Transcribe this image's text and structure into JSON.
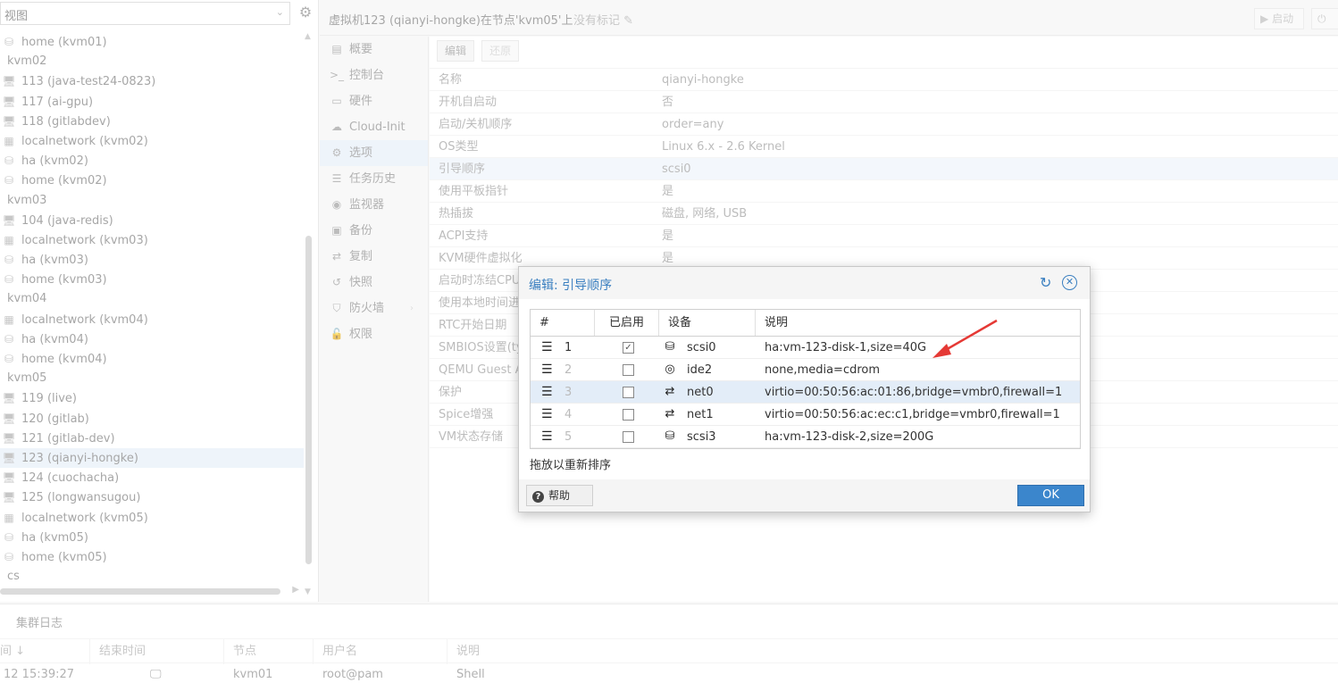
{
  "tree": {
    "view_label": "视图",
    "rows": [
      {
        "kind": "storage",
        "label": "home (kvm01)"
      },
      {
        "kind": "node",
        "label": "kvm02"
      },
      {
        "kind": "vm",
        "label": "113 (java-test24-0823)"
      },
      {
        "kind": "vm",
        "label": "117 (ai-gpu)"
      },
      {
        "kind": "vm",
        "label": "118 (gitlabdev)"
      },
      {
        "kind": "network",
        "label": "localnetwork (kvm02)"
      },
      {
        "kind": "storage",
        "label": "ha (kvm02)"
      },
      {
        "kind": "storage",
        "label": "home (kvm02)"
      },
      {
        "kind": "node",
        "label": "kvm03"
      },
      {
        "kind": "vm",
        "label": "104 (java-redis)"
      },
      {
        "kind": "network",
        "label": "localnetwork (kvm03)"
      },
      {
        "kind": "storage",
        "label": "ha (kvm03)"
      },
      {
        "kind": "storage",
        "label": "home (kvm03)"
      },
      {
        "kind": "node",
        "label": "kvm04"
      },
      {
        "kind": "network",
        "label": "localnetwork (kvm04)"
      },
      {
        "kind": "storage",
        "label": "ha (kvm04)"
      },
      {
        "kind": "storage",
        "label": "home (kvm04)"
      },
      {
        "kind": "node",
        "label": "kvm05"
      },
      {
        "kind": "vm",
        "label": "119 (live)"
      },
      {
        "kind": "vm",
        "label": "120 (gitlab)"
      },
      {
        "kind": "vm",
        "label": "121 (gitlab-dev)"
      },
      {
        "kind": "vm",
        "label": "123 (qianyi-hongke)",
        "selected": true
      },
      {
        "kind": "vm",
        "label": "124 (cuochacha)"
      },
      {
        "kind": "vm-off",
        "label": "125 (longwansugou)"
      },
      {
        "kind": "network",
        "label": "localnetwork (kvm05)"
      },
      {
        "kind": "storage",
        "label": "ha (kvm05)"
      },
      {
        "kind": "storage",
        "label": "home (kvm05)"
      },
      {
        "kind": "node",
        "label": "cs"
      }
    ]
  },
  "header": {
    "title": "虚拟机123 (qianyi-hongke)在节点'kvm05'上",
    "tags": "没有标记",
    "start_label": "启动",
    "shutdown_label": ""
  },
  "nav": {
    "items": [
      {
        "icon": "summary-icon",
        "glyph": "▤",
        "label": "概要"
      },
      {
        "icon": "console-icon",
        "glyph": ">_",
        "label": "控制台"
      },
      {
        "icon": "hardware-icon",
        "glyph": "▭",
        "label": "硬件"
      },
      {
        "icon": "cloud-icon",
        "glyph": "☁",
        "label": "Cloud-Init"
      },
      {
        "icon": "gear-icon",
        "glyph": "⚙",
        "label": "选项",
        "active": true
      },
      {
        "icon": "task-history-icon",
        "glyph": "☰",
        "label": "任务历史"
      },
      {
        "icon": "monitor-icon",
        "glyph": "◉",
        "label": "监视器"
      },
      {
        "icon": "backup-icon",
        "glyph": "▣",
        "label": "备份"
      },
      {
        "icon": "replication-icon",
        "glyph": "⇄",
        "label": "复制"
      },
      {
        "icon": "snapshot-icon",
        "glyph": "↺",
        "label": "快照"
      },
      {
        "icon": "firewall-icon",
        "glyph": "⛉",
        "label": "防火墙",
        "arrow": "›"
      },
      {
        "icon": "permissions-icon",
        "glyph": "🔓",
        "label": "权限"
      }
    ]
  },
  "options": {
    "edit_label": "编辑",
    "revert_label": "还原",
    "rows": [
      {
        "key": "名称",
        "value": "qianyi-hongke"
      },
      {
        "key": "开机自启动",
        "value": "否"
      },
      {
        "key": "启动/关机顺序",
        "value": "order=any"
      },
      {
        "key": "OS类型",
        "value": "Linux 6.x - 2.6 Kernel"
      },
      {
        "key": "引导顺序",
        "value": "scsi0",
        "selected": true
      },
      {
        "key": "使用平板指针",
        "value": "是"
      },
      {
        "key": "热插拔",
        "value": "磁盘, 网络, USB"
      },
      {
        "key": "ACPI支持",
        "value": "是"
      },
      {
        "key": "KVM硬件虚拟化",
        "value": "是"
      },
      {
        "key": "启动时冻结CPU",
        "value": ""
      },
      {
        "key": "使用本地时间进",
        "value": ""
      },
      {
        "key": "RTC开始日期",
        "value": ""
      },
      {
        "key": "SMBIOS设置(ty",
        "value": ""
      },
      {
        "key": "QEMU Guest A",
        "value": ""
      },
      {
        "key": "保护",
        "value": ""
      },
      {
        "key": "Spice增强",
        "value": ""
      },
      {
        "key": "VM状态存储",
        "value": ""
      }
    ]
  },
  "log": {
    "title": "集群日志",
    "columns": [
      "间 ↓",
      "结束时间",
      "节点",
      "用户名",
      "说明"
    ],
    "row": {
      "start": "12 15:39:27",
      "node": "kvm01",
      "user": "root@pam",
      "desc": "Shell"
    }
  },
  "dialog": {
    "title": "编辑: 引导顺序",
    "columns": {
      "num": "#",
      "enabled": "已启用",
      "device": "设备",
      "desc": "说明"
    },
    "rows": [
      {
        "num": "1",
        "enabled": true,
        "icon": "disk-icon",
        "glyph": "⛁",
        "device": "scsi0",
        "desc": "ha:vm-123-disk-1,size=40G"
      },
      {
        "num": "2",
        "enabled": false,
        "icon": "cdrom-icon",
        "glyph": "◎",
        "device": "ide2",
        "desc": "none,media=cdrom"
      },
      {
        "num": "3",
        "enabled": false,
        "icon": "network-icon",
        "glyph": "⇄",
        "device": "net0",
        "desc": "virtio=00:50:56:ac:01:86,bridge=vmbr0,firewall=1",
        "selected": true
      },
      {
        "num": "4",
        "enabled": false,
        "icon": "network-icon",
        "glyph": "⇄",
        "device": "net1",
        "desc": "virtio=00:50:56:ac:ec:c1,bridge=vmbr0,firewall=1"
      },
      {
        "num": "5",
        "enabled": false,
        "icon": "disk-icon",
        "glyph": "⛁",
        "device": "scsi3",
        "desc": "ha:vm-123-disk-2,size=200G"
      }
    ],
    "drag_hint": "拖放以重新排序",
    "help_label": "帮助",
    "ok_label": "OK"
  },
  "colors": {
    "accent": "#3a7fc0",
    "ok_button": "#3b86cc",
    "annotation_arrow": "#e53935",
    "selection": "#e5eef8"
  }
}
